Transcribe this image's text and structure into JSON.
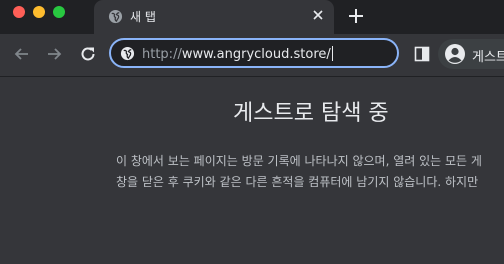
{
  "tab": {
    "title": "새 탭"
  },
  "omnibox": {
    "scheme": "http://",
    "host": "www.angrycloud.store/"
  },
  "profile": {
    "label": "게스트"
  },
  "page": {
    "heading": "게스트로 탐색 중",
    "line1": "이 창에서 보는 페이지는 방문 기록에 나타나지 않으며, 열려 있는 모든 게",
    "line2": "창을 닫은 후 쿠키와 같은 다른 흔적을 컴퓨터에 남기지 않습니다. 하지만"
  }
}
